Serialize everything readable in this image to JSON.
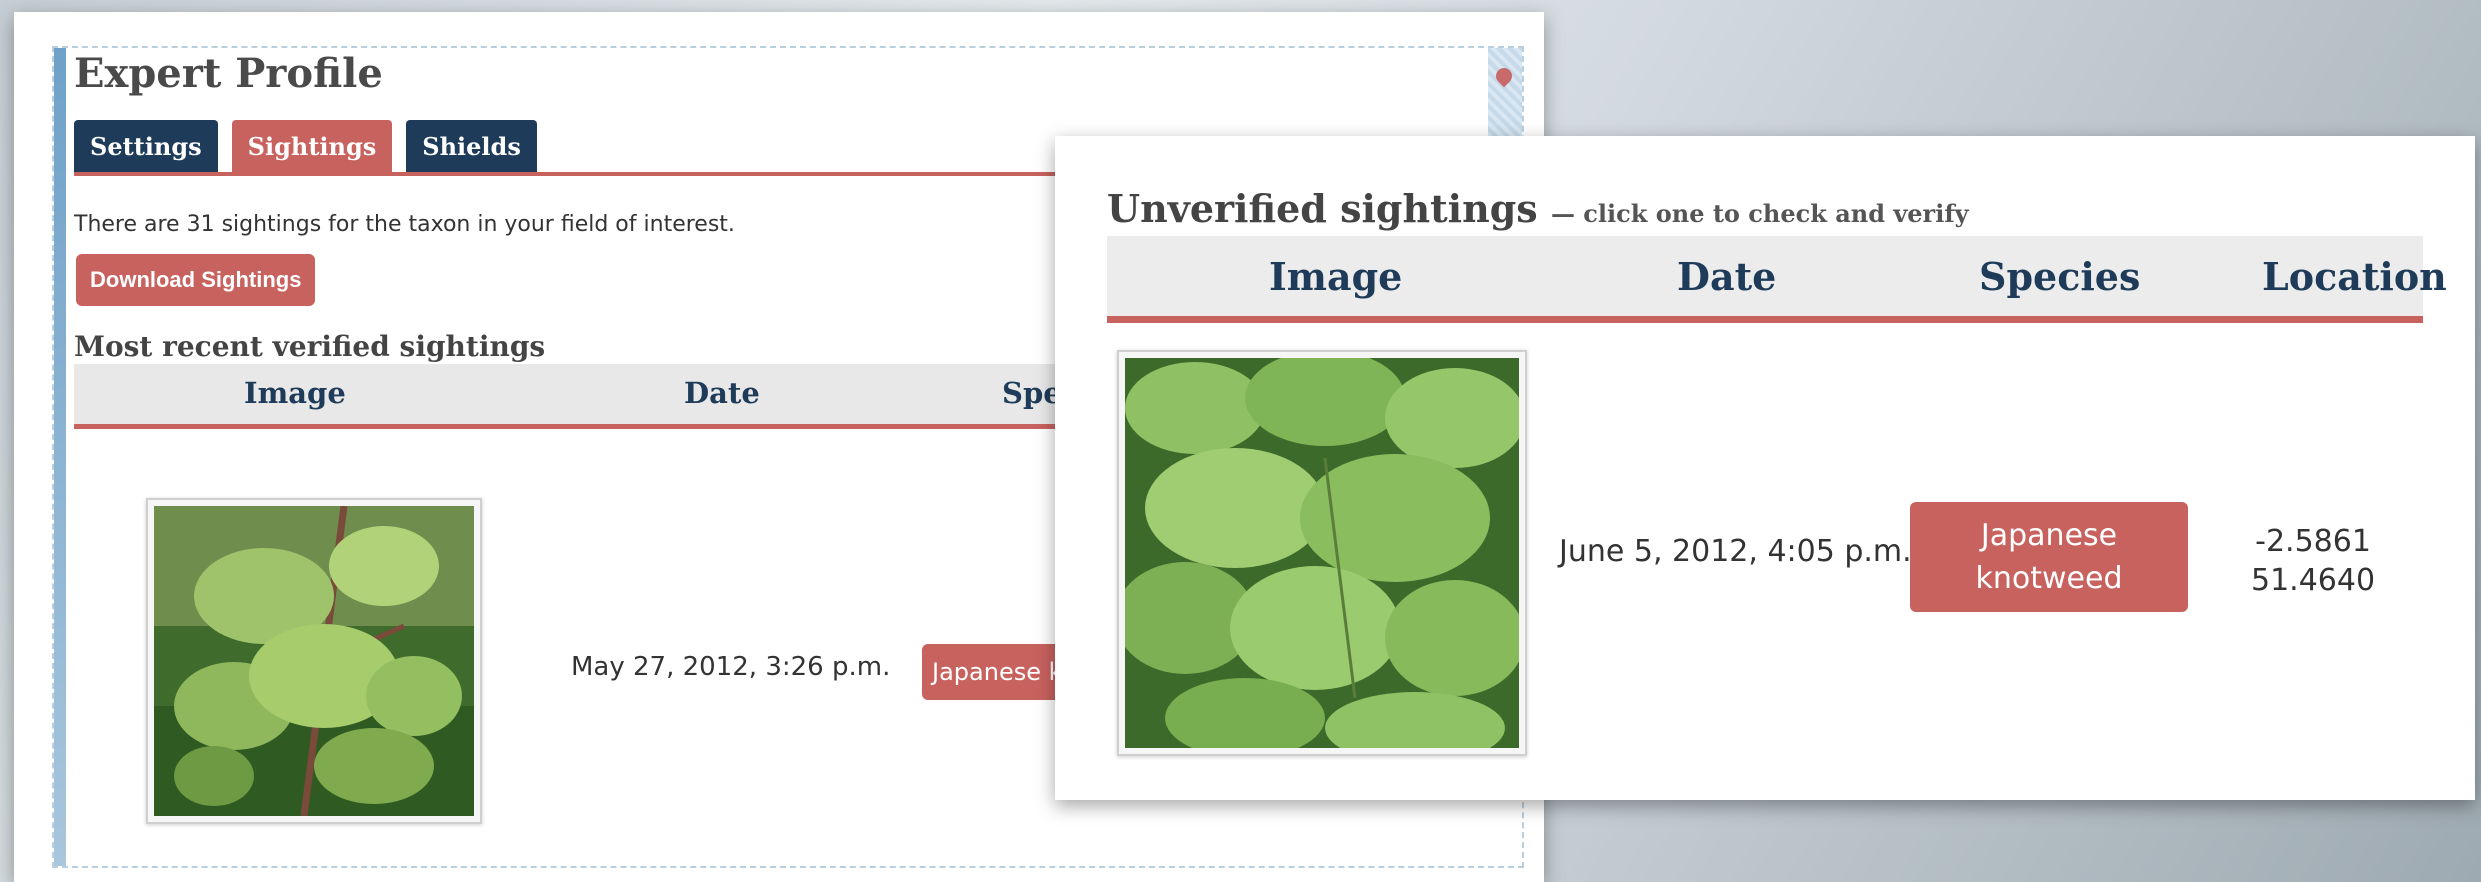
{
  "profile": {
    "title": "Expert Profile",
    "tabs": [
      {
        "label": "Settings",
        "active": false
      },
      {
        "label": "Sightings",
        "active": true
      },
      {
        "label": "Shields",
        "active": false
      }
    ],
    "sightings_count_text": "There are 31 sightings for the taxon in your field of interest.",
    "download_button": "Download Sightings",
    "verified_section_title": "Most recent verified sightings",
    "columns": [
      "Image",
      "Date",
      "Spec"
    ],
    "row": {
      "image_icon": "knotweed-photo",
      "date": "May 27, 2012, 3:26 p.m.",
      "species": "Japanese kn"
    }
  },
  "unverified": {
    "title": "Unverified sightings",
    "subtitle": "— click one to check and verify",
    "columns": [
      "Image",
      "Date",
      "Species",
      "Location"
    ],
    "row": {
      "image_icon": "knotweed-photo",
      "date": "June 5, 2012, 4:05 p.m.",
      "species_line1": "Japanese",
      "species_line2": "knotweed",
      "location_lat": "-2.5861",
      "location_lon": "51.4640"
    }
  },
  "colors": {
    "navy": "#1f3b5a",
    "accent": "#c8625f"
  }
}
